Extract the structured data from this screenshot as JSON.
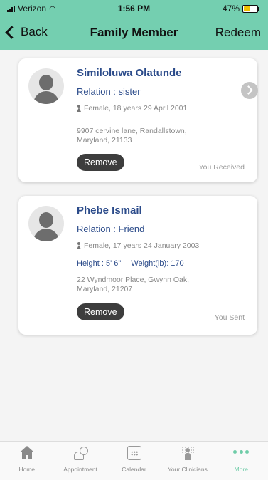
{
  "status_bar": {
    "carrier": "Verizon",
    "time": "1:56 PM",
    "battery": "47%"
  },
  "nav": {
    "back_label": "Back",
    "title": "Family Member",
    "redeem_label": "Redeem"
  },
  "members": [
    {
      "name": "Similoluwa Olatunde",
      "relation": "Relation : sister",
      "details": "Female, 18 years 29 April 2001",
      "address_line1": "9907 cervine lane, Randallstown,",
      "address_line2": "Maryland, 21133",
      "remove_label": "Remove",
      "status": "You Received"
    },
    {
      "name": "Phebe Ismail",
      "relation": "Relation : Friend",
      "details": "Female, 17 years 24 January 2003",
      "height": "Height : 5' 6\"",
      "weight": "Weight(lb): 170",
      "address_line1": "22 Wyndmoor Place, Gwynn Oak,",
      "address_line2": "Maryland, 21207",
      "remove_label": "Remove",
      "status": "You Sent"
    }
  ],
  "tabbar": {
    "tabs": [
      {
        "label": "Home",
        "icon": "home-icon"
      },
      {
        "label": "Appointment",
        "icon": "appointment-icon"
      },
      {
        "label": "Calendar",
        "icon": "calendar-icon"
      },
      {
        "label": "Your Clinicians",
        "icon": "clinicians-icon"
      },
      {
        "label": "More",
        "icon": "more-icon",
        "active": true
      }
    ]
  },
  "colors": {
    "header": "#74cfb0",
    "accent": "#6fcca8",
    "name_text": "#2b4b8a",
    "button": "#3d3d3d"
  }
}
